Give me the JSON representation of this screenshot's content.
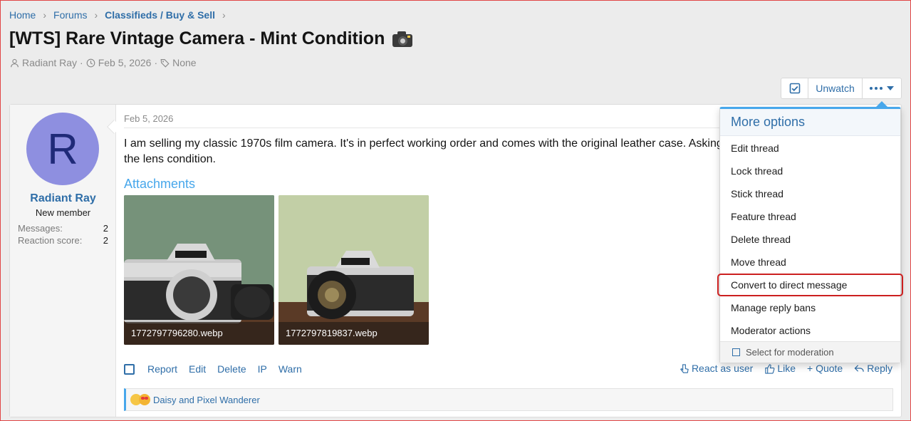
{
  "breadcrumb": {
    "items": [
      "Home",
      "Forums",
      "Classifieds / Buy & Sell"
    ]
  },
  "thread": {
    "title": "[WTS] Rare Vintage Camera - Mint Condition",
    "author": "Radiant Ray",
    "date": "Feb 5, 2026",
    "tags": "None"
  },
  "toolbar": {
    "unwatch_label": "Unwatch"
  },
  "user": {
    "avatar_letter": "R",
    "name": "Radiant Ray",
    "title": "New member",
    "messages_label": "Messages:",
    "messages_value": "2",
    "reaction_label": "Reaction score:",
    "reaction_value": "2"
  },
  "post": {
    "date": "Feb 5, 2026",
    "body": "I am selling my classic 1970s film camera. It's in perfect working order and comes with the original leather case. Asking f... the lens condition.",
    "body_line1": "I am selling my classic 1970s film camera. It's in perfect working order and comes with the original leather case. Asking f",
    "body_line2": "the lens condition.",
    "attachments_title": "Attachments",
    "attachments": [
      {
        "filename": "1772797796280.webp"
      },
      {
        "filename": "1772797819837.webp"
      }
    ],
    "actions": [
      "Report",
      "Edit",
      "Delete",
      "IP",
      "Warn"
    ],
    "actions_right": [
      "React as user",
      "Like",
      "+ Quote",
      "Reply"
    ],
    "reactions_text": "Daisy and Pixel Wanderer"
  },
  "menu": {
    "header": "More options",
    "items": [
      "Edit thread",
      "Lock thread",
      "Stick thread",
      "Feature thread",
      "Delete thread",
      "Move thread",
      "Convert to direct message",
      "Manage reply bans",
      "Moderator actions"
    ],
    "highlighted_index": 6,
    "footer": "Select for moderation"
  },
  "colors": {
    "link": "#2f6ea8",
    "accent": "#47a7eb",
    "highlight_outline": "#cc1f1f",
    "avatar_bg": "#8e8fe0"
  }
}
